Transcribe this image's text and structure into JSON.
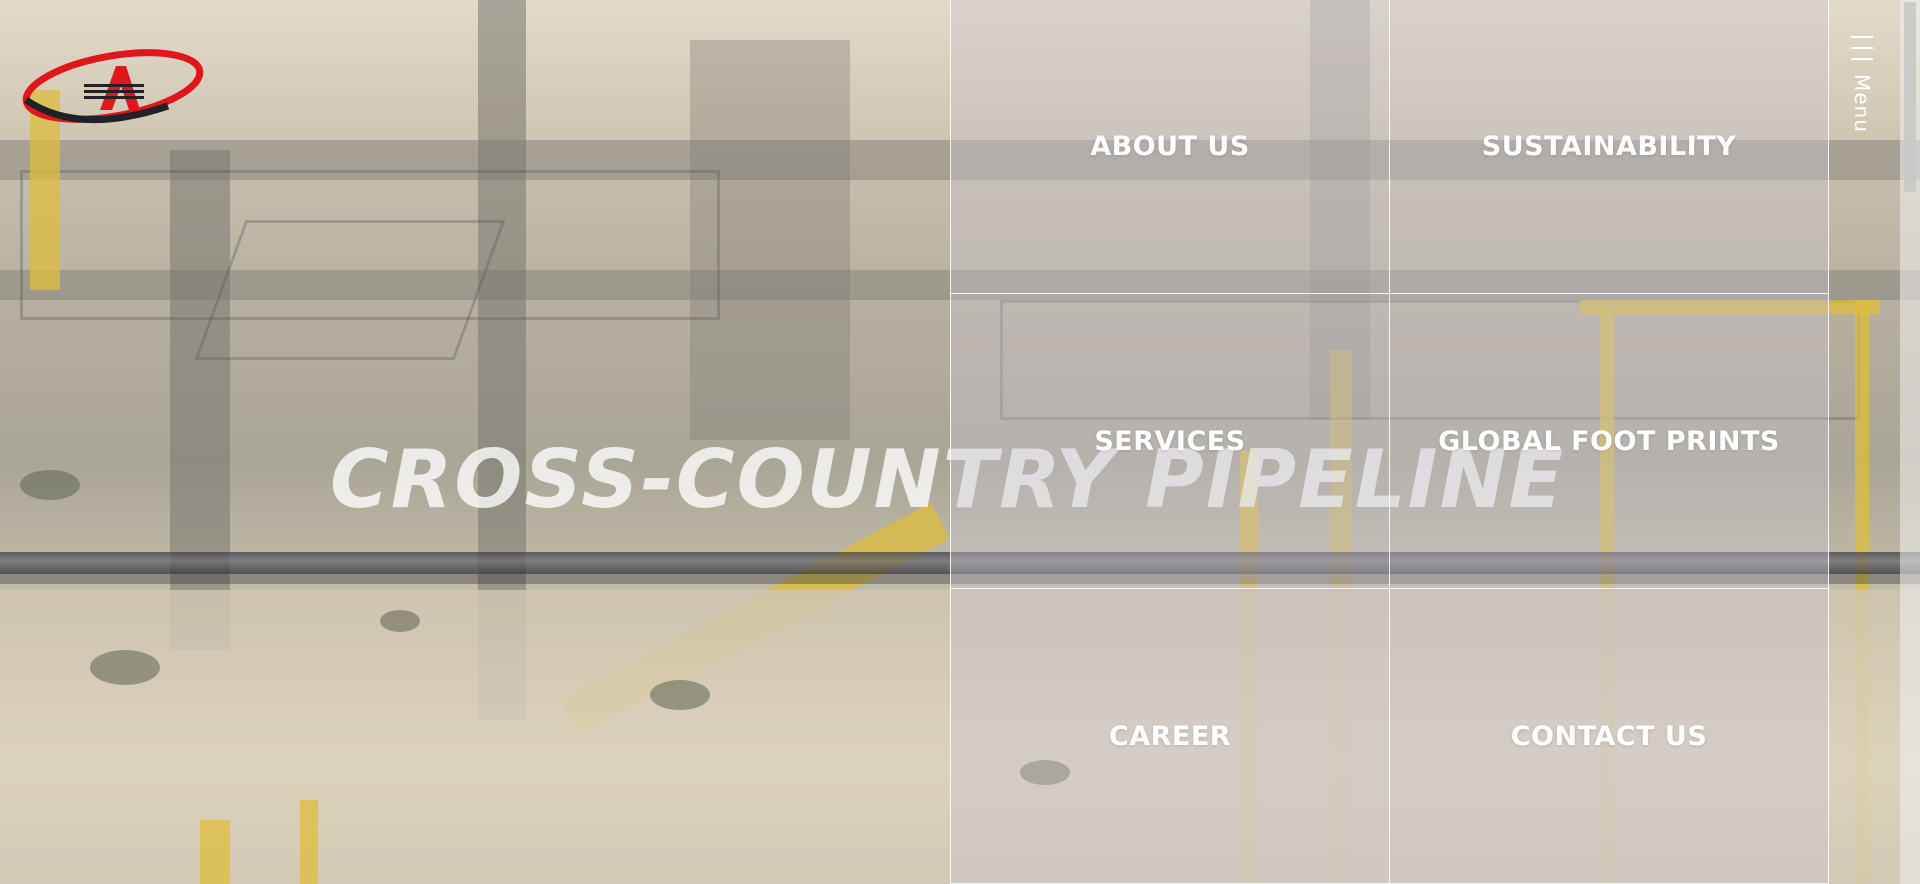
{
  "brand": {
    "logo_letter": "A",
    "colors": {
      "red": "#e0161c",
      "dark": "#222226"
    }
  },
  "hero": {
    "title": "CROSS-COUNTRY PIPELINE"
  },
  "menu": {
    "toggle_label": "Menu",
    "items": [
      {
        "label": "ABOUT US"
      },
      {
        "label": "SUSTAINABILITY"
      },
      {
        "label": "SERVICES"
      },
      {
        "label": "GLOBAL FOOT PRINTS"
      },
      {
        "label": "CAREER"
      },
      {
        "label": "CONTACT US"
      }
    ]
  },
  "icons": {
    "menu_toggle": "hamburger-icon"
  }
}
